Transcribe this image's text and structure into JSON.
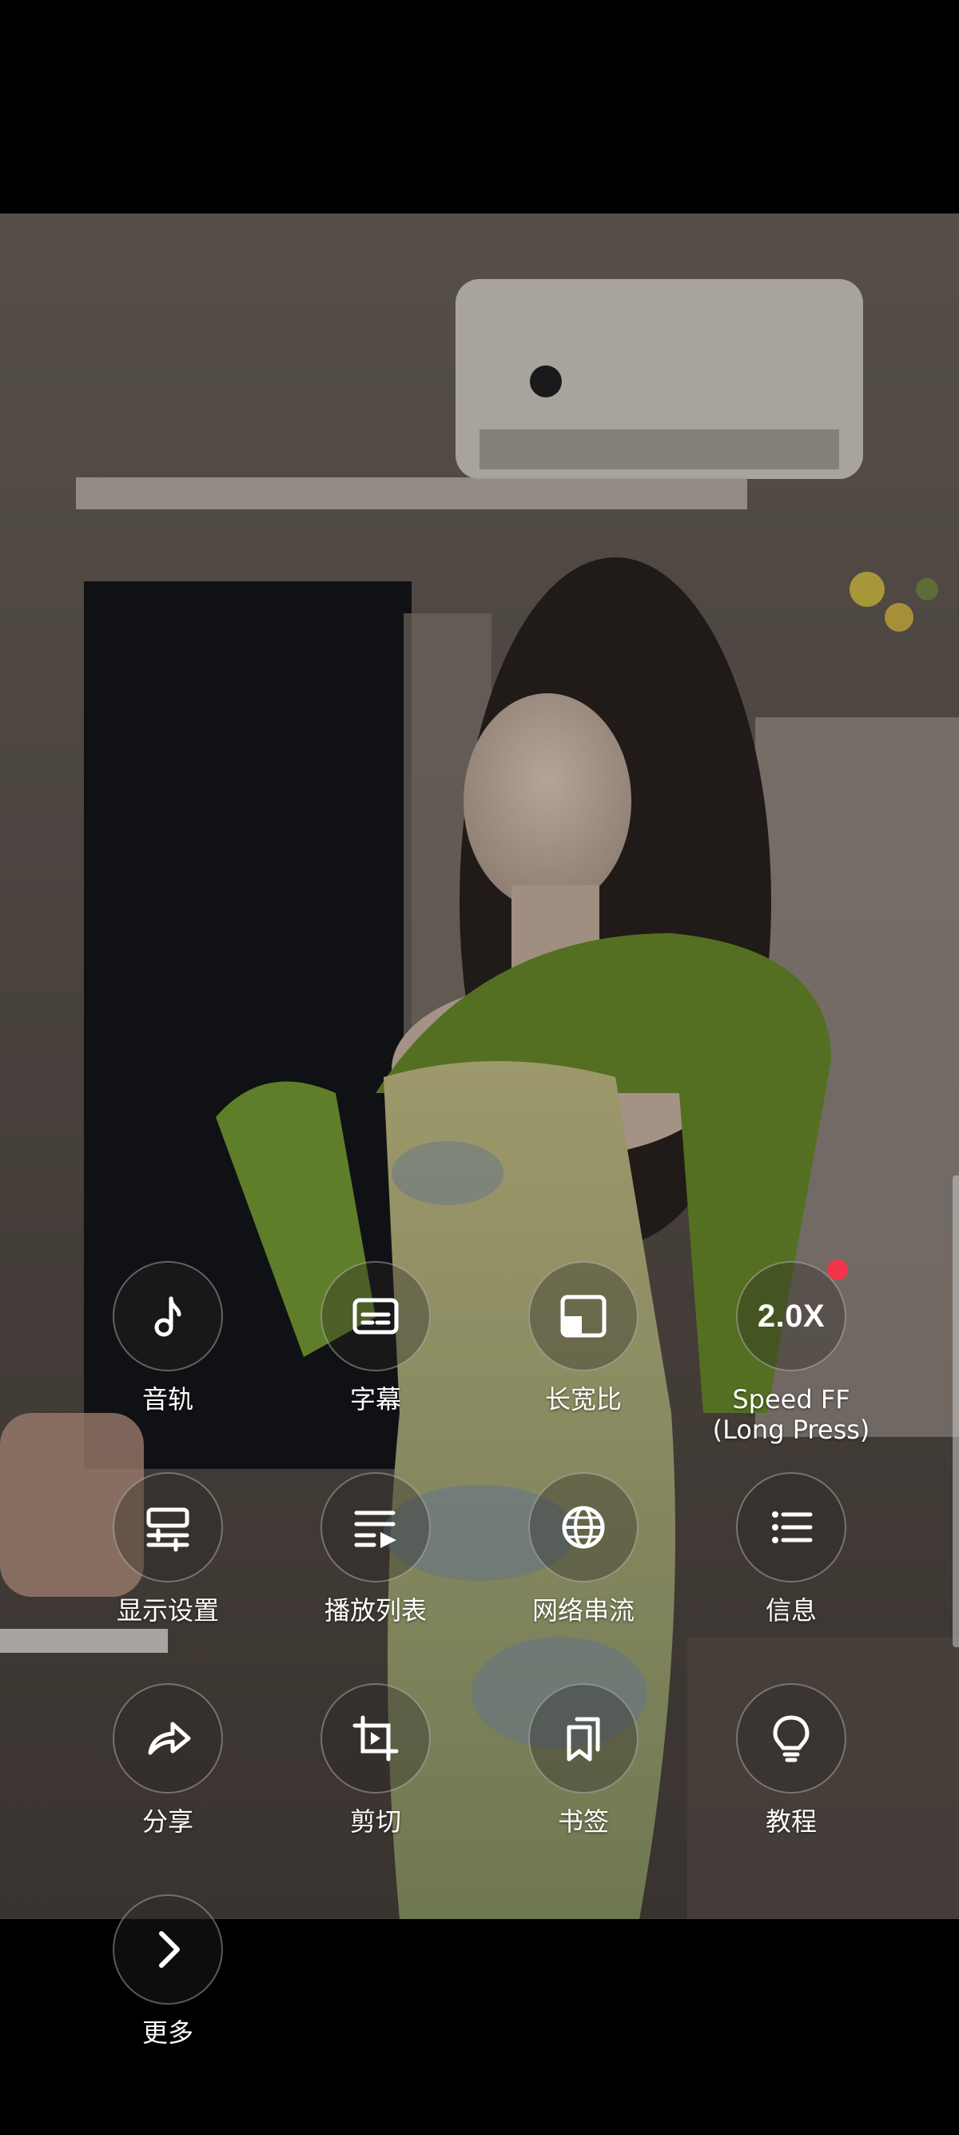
{
  "menu": {
    "items": [
      {
        "id": "audio-track",
        "label": "音轨",
        "icon": "music-note-icon"
      },
      {
        "id": "subtitles",
        "label": "字幕",
        "icon": "subtitles-icon"
      },
      {
        "id": "aspect-ratio",
        "label": "长宽比",
        "icon": "aspect-ratio-icon"
      },
      {
        "id": "speed",
        "label": "Speed FF\n(Long Press)",
        "icon_text": "2.0X",
        "badge": true
      },
      {
        "id": "display-settings",
        "label": "显示设置",
        "icon": "display-settings-icon"
      },
      {
        "id": "playlist",
        "label": "播放列表",
        "icon": "playlist-icon"
      },
      {
        "id": "network-stream",
        "label": "网络串流",
        "icon": "globe-icon"
      },
      {
        "id": "info",
        "label": "信息",
        "icon": "list-icon"
      },
      {
        "id": "share",
        "label": "分享",
        "icon": "share-icon"
      },
      {
        "id": "trim",
        "label": "剪切",
        "icon": "crop-video-icon"
      },
      {
        "id": "bookmarks",
        "label": "书签",
        "icon": "bookmark-icon"
      },
      {
        "id": "tutorial",
        "label": "教程",
        "icon": "lightbulb-icon"
      },
      {
        "id": "more",
        "label": "更多",
        "icon": "chevron-right-icon"
      }
    ]
  },
  "colors": {
    "badge": "#f2354a",
    "label": "#ffffff",
    "background": "#000000"
  }
}
